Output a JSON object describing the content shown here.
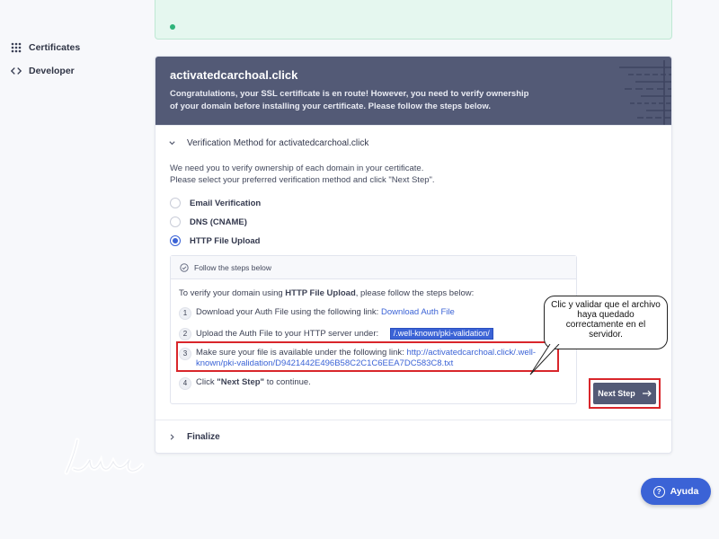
{
  "sidebar": {
    "items": [
      {
        "label": "Certificates",
        "icon": "grid-dots-icon"
      },
      {
        "label": "Developer",
        "icon": "code-brackets-icon"
      }
    ]
  },
  "card": {
    "domain": "activatedcarchoal.click",
    "intro": "Congratulations, your SSL certificate is en route! However, you need to verify ownership of your domain before installing your certificate. Please follow the steps below.",
    "section_title": "Verification Method for activatedcarchoal.click",
    "description_line1": "We need you to verify ownership of each domain in your certificate.",
    "description_line2": "Please select your preferred verification method and click \"Next Step\".",
    "methods": [
      {
        "label": "Email Verification",
        "selected": false
      },
      {
        "label": "DNS (CNAME)",
        "selected": false
      },
      {
        "label": "HTTP File Upload",
        "selected": true
      }
    ],
    "steps_header": "Follow the steps below",
    "steps_intro_prefix": "To verify your domain using ",
    "steps_intro_method": "HTTP File Upload",
    "steps_intro_suffix": ", please follow the steps below:",
    "steps": {
      "s1_num": "1",
      "s1_text": "Download your Auth File using the following link:",
      "s1_link": "Download Auth File",
      "s2_num": "2",
      "s2_text": "Upload the Auth File to your HTTP server under:",
      "s2_path": "/.well-known/pki-validation/",
      "s3_num": "3",
      "s3_text": "Make sure your file is available under the following link:",
      "s3_link_a": "http://activatedcarchoal.click/.well-",
      "s3_link_b": "known/pki-validation/D9421442E496B58C2C1C6EEA7DC583C8.txt",
      "s4_num": "4",
      "s4_prefix": "Click ",
      "s4_bold": "\"Next Step\"",
      "s4_suffix": " to continue."
    },
    "next_button": "Next Step",
    "finalize": "Finalize"
  },
  "annotation": {
    "callout": "Clic y validar que el archivo haya quedado correctamente en el servidor.",
    "highlight_color": "#d9262b"
  },
  "help_button": "Ayuda",
  "colors": {
    "header_bg": "#535a76",
    "accent": "#3b63d6",
    "success_strip": "#e5f7ef"
  }
}
